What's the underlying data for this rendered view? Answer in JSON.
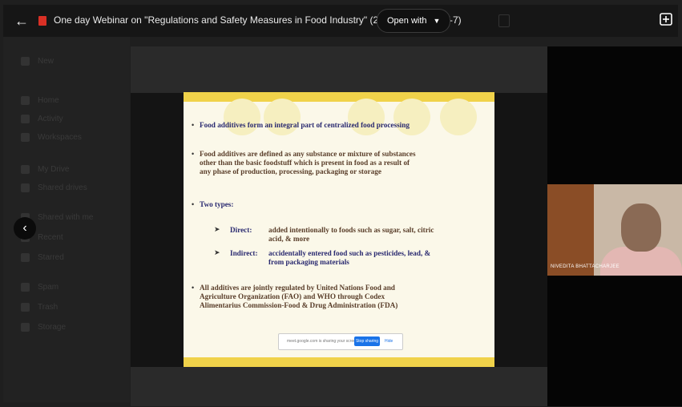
{
  "topbar": {
    "title": "One day Webinar on \"Regulations and Safety Measures in Food Industry\" (2020-C",
    "title_tail": "IT-7)",
    "open_with_label": "Open with",
    "back_icon": "arrow-left-icon",
    "add_icon": "add-to-drive-icon"
  },
  "sidebar": {
    "items": [
      {
        "label": "New"
      },
      {
        "label": "Home"
      },
      {
        "label": "Activity"
      },
      {
        "label": "Workspaces"
      },
      {
        "label": "My Drive"
      },
      {
        "label": "Shared drives"
      },
      {
        "label": "Shared with me"
      },
      {
        "label": "Recent"
      },
      {
        "label": "Starred"
      },
      {
        "label": "Spam"
      },
      {
        "label": "Trash"
      },
      {
        "label": "Storage"
      }
    ]
  },
  "slide": {
    "bullet1": "Food additives form an integral part of centralized food processing",
    "bullet2_l1": "Food additives are defined as any substance or mixture of substances",
    "bullet2_l2": "other than the basic foodstuff which is present in food as a result of",
    "bullet2_l3": "any phase of production, processing, packaging or storage",
    "bullet3": "Two types:",
    "direct_key": "Direct:",
    "direct_l1": "added intentionally to foods such as sugar, salt, citric",
    "direct_l2": "acid, & more",
    "indirect_key": "Indirect:",
    "indirect_l1": "accidentally entered food such as pesticides, lead, &",
    "indirect_l2": "from packaging materials",
    "bullet4_l1": "All additives are jointly regulated by United Nations Food and",
    "bullet4_l2": "Agriculture Organization (FAO) and WHO through Codex",
    "bullet4_l3": "Alimentarius Commission-Food & Drug Administration (FDA)"
  },
  "sharebar": {
    "text": "meet.google.com is sharing your screen.",
    "stop_label": "Stop sharing",
    "hide_label": "Hide"
  },
  "webcam": {
    "name": "NIVEDITA BHATTACHARJEE"
  },
  "colors": {
    "slide_band": "#f0d24a",
    "slide_bg": "#fbf8e9",
    "accent_blue": "#1a73e8"
  }
}
